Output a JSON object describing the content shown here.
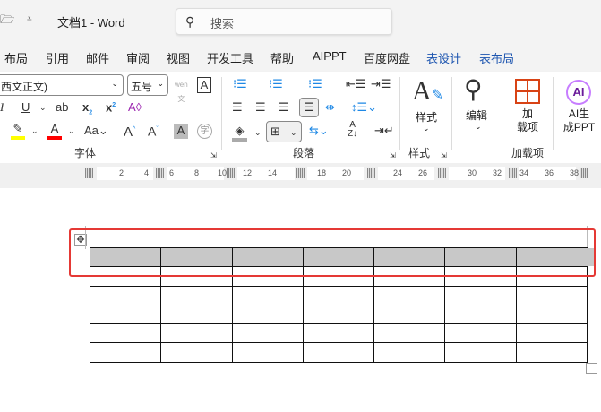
{
  "titlebar": {
    "title": "文档1  -  Word",
    "search_placeholder": "搜索"
  },
  "tabs": [
    {
      "label": "布局"
    },
    {
      "label": "引用"
    },
    {
      "label": "邮件"
    },
    {
      "label": "审阅"
    },
    {
      "label": "视图"
    },
    {
      "label": "开发工具"
    },
    {
      "label": "帮助"
    },
    {
      "label": "AIPPT"
    },
    {
      "label": "百度网盘"
    },
    {
      "label": "表设计",
      "contextual": true
    },
    {
      "label": "表布局",
      "contextual": true
    }
  ],
  "font": {
    "font_name": "西文正文)",
    "font_size": "五号",
    "group_label": "字体"
  },
  "paragraph": {
    "group_label": "段落"
  },
  "styles": {
    "button_label": "样式",
    "group_label": "样式"
  },
  "editing": {
    "button_label": "编辑"
  },
  "addins": {
    "button_label": "加\n载项",
    "group_label": "加载项"
  },
  "aippt": {
    "button_label": "AI生\n成PPT"
  },
  "ruler": {
    "ticks": [
      "2",
      "4",
      "6",
      "8",
      "10",
      "12",
      "14",
      "18",
      "20",
      "24",
      "26",
      "30",
      "32",
      "34",
      "36",
      "38"
    ]
  },
  "colors": {
    "highlight": "#ffff00",
    "font_color": "#ff0000",
    "accent": "#1e56b0",
    "selection_box": "#e53935",
    "header_fill": "#c8c8c8"
  },
  "table": {
    "columns": 7,
    "rows": 6
  }
}
